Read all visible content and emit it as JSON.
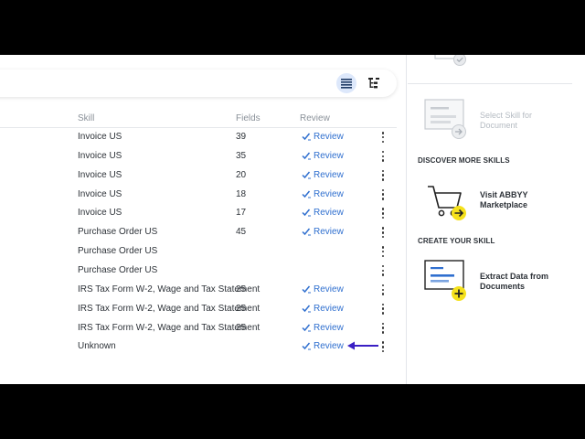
{
  "table": {
    "headers": {
      "skill": "Skill",
      "fields": "Fields",
      "review": "Review"
    },
    "rows": [
      {
        "skill": "Invoice US",
        "fields": "39",
        "review": "Review"
      },
      {
        "skill": "Invoice US",
        "fields": "35",
        "review": "Review"
      },
      {
        "skill": "Invoice US",
        "fields": "20",
        "review": "Review"
      },
      {
        "skill": "Invoice US",
        "fields": "18",
        "review": "Review"
      },
      {
        "skill": "Invoice US",
        "fields": "17",
        "review": "Review"
      },
      {
        "skill": "Purchase Order US",
        "fields": "45",
        "review": "Review"
      },
      {
        "skill": "Purchase Order US",
        "fields": "",
        "review": ""
      },
      {
        "skill": "Purchase Order US",
        "fields": "",
        "review": ""
      },
      {
        "skill": "IRS Tax Form W-2, Wage and Tax Statement",
        "fields": "25",
        "review": "Review"
      },
      {
        "skill": "IRS Tax Form W-2, Wage and Tax Statement",
        "fields": "25",
        "review": "Review"
      },
      {
        "skill": "IRS Tax Form W-2, Wage and Tax Statement",
        "fields": "25",
        "review": "Review"
      },
      {
        "skill": "Unknown",
        "fields": "",
        "review": "Review"
      }
    ]
  },
  "side": {
    "select_skill": "Select Skill for Document",
    "discover_heading": "DISCOVER MORE SKILLS",
    "marketplace": "Visit ABBYY Marketplace",
    "create_heading": "CREATE YOUR SKILL",
    "extract": "Extract Data from Documents"
  },
  "colors": {
    "accent": "#2f6fcf",
    "highlight": "#f5e11c",
    "arrow": "#3a1fc4"
  }
}
